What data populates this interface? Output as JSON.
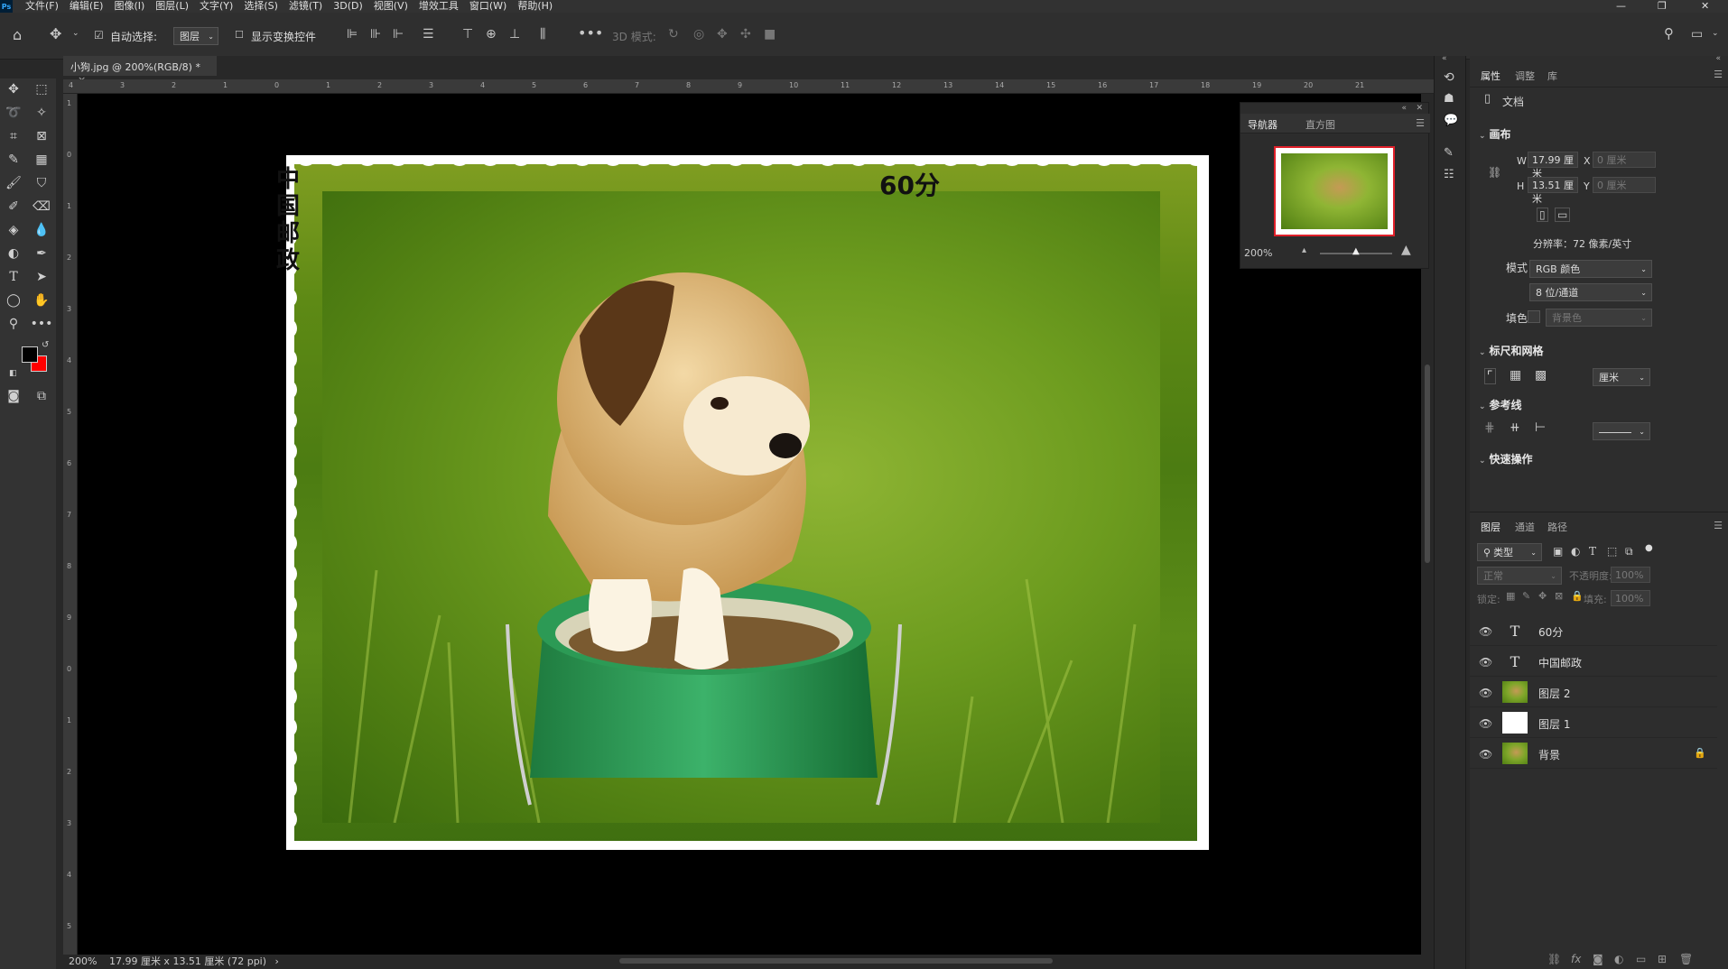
{
  "menu": {
    "app_badge": "Ps",
    "items": [
      "文件(F)",
      "编辑(E)",
      "图像(I)",
      "图层(L)",
      "文字(Y)",
      "选择(S)",
      "滤镜(T)",
      "3D(D)",
      "视图(V)",
      "增效工具",
      "窗口(W)",
      "帮助(H)"
    ]
  },
  "options": {
    "auto_select_label": "自动选择:",
    "auto_select_value": "图层",
    "show_transform_label": "显示变换控件",
    "mode_3d_label": "3D 模式:"
  },
  "doc_tab": {
    "title": "小狗.jpg @ 200%(RGB/8) *",
    "close": "×"
  },
  "ruler_top": [
    "4",
    "3",
    "2",
    "1",
    "0",
    "1",
    "2",
    "3",
    "4",
    "5",
    "6",
    "7",
    "8",
    "9",
    "10",
    "11",
    "12",
    "13",
    "14",
    "15",
    "16",
    "17",
    "18",
    "19",
    "20",
    "21"
  ],
  "ruler_left": [
    "1",
    "0",
    "1",
    "2",
    "3",
    "4",
    "5",
    "6",
    "7",
    "8",
    "9",
    "0",
    "1",
    "2",
    "3",
    "4",
    "5"
  ],
  "stamp": {
    "country": "中国邮政",
    "value": "60分"
  },
  "status": {
    "zoom": "200%",
    "info": "17.99 厘米 x 13.51 厘米 (72 ppi)",
    "arrow": "›"
  },
  "navigator": {
    "tab_nav": "导航器",
    "tab_hist": "直方图",
    "zoom": "200%"
  },
  "properties": {
    "tab_props": "属性",
    "tab_adjust": "调整",
    "tab_lib": "库",
    "doc_label": "文档",
    "canvas_title": "画布",
    "w_label": "W",
    "w_value": "17.99 厘米",
    "x_label": "X",
    "x_value": "0 厘米",
    "h_label": "H",
    "h_value": "13.51 厘米",
    "y_label": "Y",
    "y_value": "0 厘米",
    "resolution": "分辨率：72 像素/英寸",
    "mode_label": "模式",
    "mode_value": "RGB 颜色",
    "depth_value": "8 位/通道",
    "fill_label": "填色",
    "fill_value": "背景色",
    "rulers_title": "标尺和网格",
    "unit_value": "厘米",
    "guides_title": "参考线",
    "quick_title": "快速操作"
  },
  "layers_panel": {
    "tab_layers": "图层",
    "tab_channels": "通道",
    "tab_paths": "路径",
    "filter_label": "类型",
    "blend_mode": "正常",
    "opacity_label": "不透明度:",
    "opacity_value": "100%",
    "lock_label": "锁定:",
    "fill_label": "填充:",
    "fill_value": "100%",
    "layers": [
      {
        "name": "60分",
        "type": "text"
      },
      {
        "name": "中国邮政",
        "type": "text"
      },
      {
        "name": "图层 2",
        "type": "image"
      },
      {
        "name": "图层 1",
        "type": "white"
      },
      {
        "name": "背景",
        "type": "image"
      }
    ]
  }
}
